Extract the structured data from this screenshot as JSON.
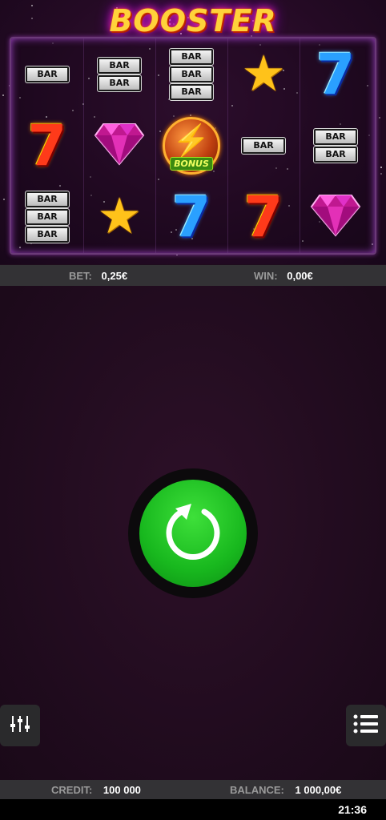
{
  "game": {
    "logo_text": "BOOSTER"
  },
  "reels": [
    [
      "bar-1",
      "seven-red",
      "bar-3"
    ],
    [
      "bar-2",
      "diamond",
      "star"
    ],
    [
      "bar-3",
      "bonus",
      "seven-blue"
    ],
    [
      "star",
      "bar-1",
      "seven-red"
    ],
    [
      "seven-blue",
      "bar-2",
      "diamond"
    ]
  ],
  "symbols": {
    "bar_text": "BAR",
    "bonus_text": "BONUS",
    "seven_text": "7",
    "star_glyph": "★"
  },
  "info": {
    "bet_label": "BET:",
    "bet_value": "0,25€",
    "win_label": "WIN:",
    "win_value": "0,00€"
  },
  "footer": {
    "credit_label": "CREDIT:",
    "credit_value": "100 000",
    "balance_label": "BALANCE:",
    "balance_value": "1 000,00€"
  },
  "status": {
    "time": "21:36"
  },
  "icons": {
    "spin": "refresh-arrow-icon",
    "settings": "sliders-icon",
    "menu": "list-menu-icon"
  },
  "colors": {
    "spin_green": "#1fbf22",
    "bar_bg": "#333235"
  }
}
